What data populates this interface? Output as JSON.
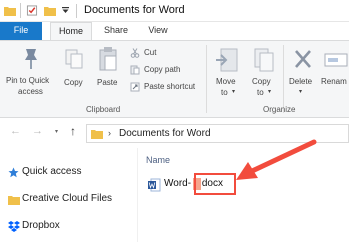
{
  "window": {
    "title": "Documents for Word"
  },
  "quick_access_toolbar": {
    "icons": [
      "folder-icon",
      "properties-checkmark-icon",
      "new-folder-icon",
      "customize-dropdown-icon"
    ]
  },
  "tabs": {
    "file": "File",
    "home": "Home",
    "share": "Share",
    "view": "View"
  },
  "ribbon": {
    "clipboard": {
      "group_label": "Clipboard",
      "pin_label_1": "Pin to Quick",
      "pin_label_2": "access",
      "copy_label": "Copy",
      "paste_label": "Paste",
      "cut_label": "Cut",
      "copy_path_label": "Copy path",
      "paste_shortcut_label": "Paste shortcut"
    },
    "organize": {
      "group_label": "Organize",
      "move_to_1": "Move",
      "move_to_2": "to",
      "copy_to_1": "Copy",
      "copy_to_2": "to",
      "delete_label": "Delete",
      "rename_label": "Renam"
    }
  },
  "navigation": {
    "address_path": "Documents for Word"
  },
  "sidebar": {
    "items": [
      {
        "label": "Quick access",
        "icon": "star-icon"
      },
      {
        "label": "Creative Cloud Files",
        "icon": "folder-icon"
      },
      {
        "label": "Dropbox",
        "icon": "dropbox-icon"
      }
    ]
  },
  "file_list": {
    "column_name": "Name",
    "files": [
      {
        "name_prefix": "Word-",
        "name_suffix": ".docx",
        "icon": "word-document-icon"
      }
    ]
  },
  "colors": {
    "file_tab": "#1979ca",
    "annotation_red": "#f24c3d",
    "folder_yellow": "#f0c04a",
    "ribbon_bg": "#f5f6f7"
  }
}
